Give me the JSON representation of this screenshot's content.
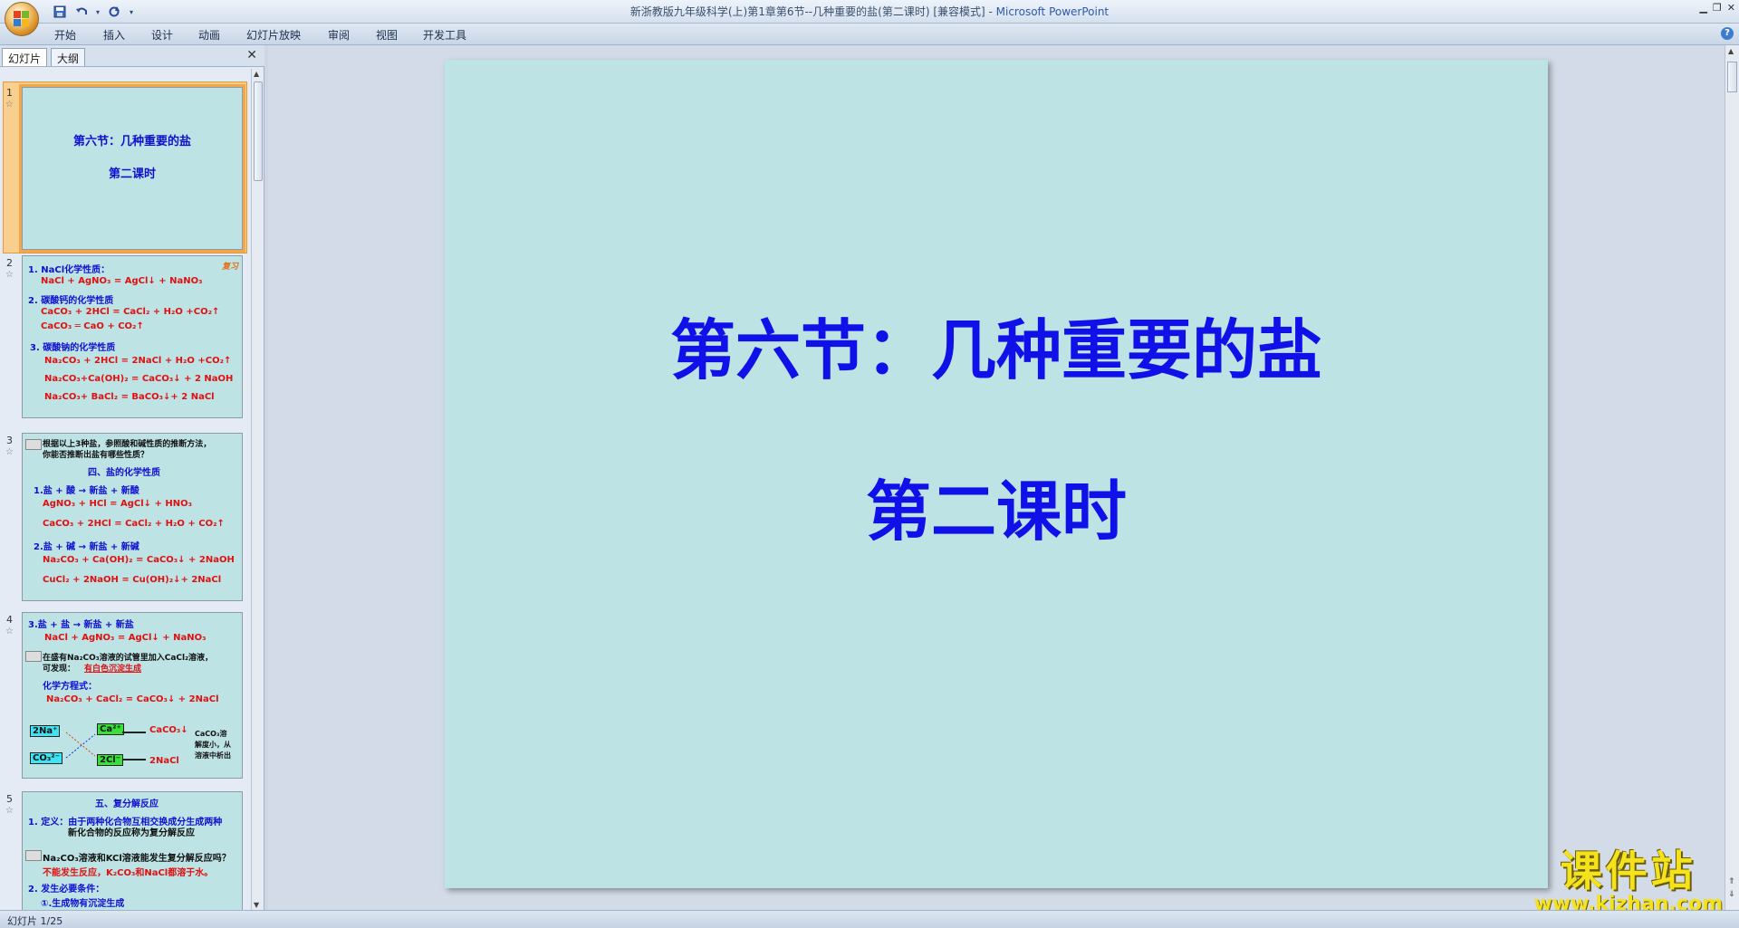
{
  "window": {
    "title": "新浙教版九年级科学(上)第1章第6节--几种重要的盐(第二课时) [兼容模式] - ",
    "app": "Microsoft PowerPoint",
    "minimize": "▁",
    "restore": "❐",
    "close": "✕"
  },
  "ribbon": {
    "tabs": [
      "开始",
      "插入",
      "设计",
      "动画",
      "幻灯片放映",
      "审阅",
      "视图",
      "开发工具"
    ]
  },
  "pane": {
    "tab_slides": "幻灯片",
    "tab_outline": "大纲",
    "close": "✕"
  },
  "thumbnails": {
    "s1": {
      "num": "1",
      "title": "第六节：几种重要的盐",
      "subtitle": "第二课时"
    },
    "s2": {
      "num": "2",
      "badge": "复习",
      "lines": [
        "1. NaCl化学性质：",
        "NaCl + AgNO₃ = AgCl↓ + NaNO₃",
        "2. 碳酸钙的化学性质",
        "CaCO₃ + 2HCl = CaCl₂ + H₂O +CO₂↑",
        "CaCO₃ ═ CaO + CO₂↑",
        "3. 碳酸钠的化学性质",
        "Na₂CO₃ + 2HCl = 2NaCl + H₂O +CO₂↑",
        "Na₂CO₃+Ca(OH)₂ = CaCO₃↓ + 2 NaOH",
        "Na₂CO₃+ BaCl₂ = BaCO₃↓+ 2 NaCl"
      ]
    },
    "s3": {
      "num": "3",
      "lines": [
        "根据以上3种盐，参照酸和碱性质的推断方法，",
        "你能否推断出盐有哪些性质？",
        "四、盐的化学性质",
        "1.盐 + 酸 → 新盐 + 新酸",
        "AgNO₃ + HCl = AgCl↓ + HNO₃",
        "CaCO₃ + 2HCl = CaCl₂ + H₂O + CO₂↑",
        "2.盐 + 碱 → 新盐 + 新碱",
        "Na₂CO₃ + Ca(OH)₂ = CaCO₃↓ + 2NaOH",
        "CuCl₂ + 2NaOH = Cu(OH)₂↓+ 2NaCl"
      ]
    },
    "s4": {
      "num": "4",
      "lines": [
        "3.盐 + 盐 → 新盐 + 新盐",
        "NaCl + AgNO₃ = AgCl↓ + NaNO₃",
        "在盛有Na₂CO₃溶液的试管里加入CaCl₂溶液，",
        "可发现：",
        "有白色沉淀生成",
        "化学方程式：",
        "Na₂CO₃ + CaCl₂ = CaCO₃↓ + 2NaCl",
        "2Na⁺",
        "Ca²⁺",
        "CaCO₃↓",
        "CO₃²⁻",
        "2Cl⁻",
        "2NaCl",
        "CaCO₃溶",
        "解度小，从",
        "溶液中析出"
      ]
    },
    "s5": {
      "num": "5",
      "lines": [
        "五、复分解反应",
        "1. 定义：由于两种化合物互相交换成分生成两种",
        "新化合物的反应称为复分解反应",
        "Na₂CO₃溶液和KCl溶液能发生复分解反应吗？",
        "不能发生反应，K₂CO₃和NaCl都溶于水。",
        "2. 发生必要条件：",
        "①.生成物有沉淀生成"
      ]
    }
  },
  "slide": {
    "title": "第六节：几种重要的盐",
    "subtitle": "第二课时"
  },
  "status": {
    "text": "幻灯片 1/25"
  },
  "watermark": {
    "logo_text": "课件站",
    "url": "www.kjzhan.com"
  }
}
